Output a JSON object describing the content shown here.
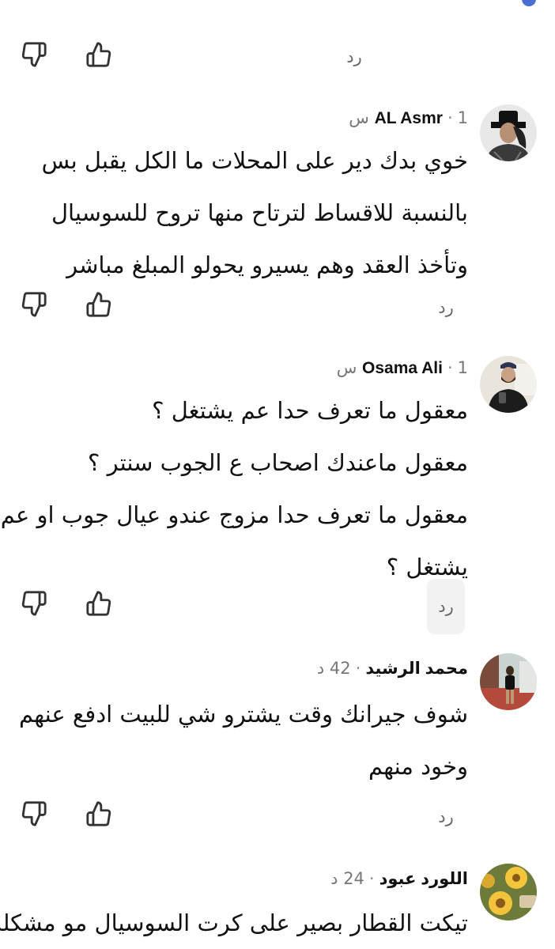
{
  "ui": {
    "reply_label": "رد",
    "dot_sep": "·",
    "accent_color": "#4a6fd4"
  },
  "comments": [
    {
      "author": "AL Asmr",
      "time": "1 س",
      "lines": [
        "خوي بدك دير على المحلات ما الكل يقبل بس",
        "بالنسبة للاقساط لترتاح منها تروح للسوسيال",
        "وتأخذ العقد وهم يسيرو يحولو المبلغ مباشر"
      ]
    },
    {
      "author": "Osama Ali",
      "time": "1 س",
      "lines": [
        "معقول ما تعرف حدا عم يشتغل ؟",
        "معقول ماعندك اصحاب ع الجوب سنتر ؟",
        "معقول ما تعرف حدا مزوج عندو عيال جوب او عم",
        "يشتغل ؟"
      ]
    },
    {
      "author": "محمد الرشيد",
      "time": "42 د",
      "lines": [
        "شوف جيرانك وقت يشترو شي للبيت ادفع عنهم",
        "وخود منهم"
      ]
    },
    {
      "author": "اللورد عبود",
      "time": "24 د",
      "lines": [
        "تيكت القطار بصير على كرت السوسيال مو مشكلة"
      ]
    }
  ]
}
